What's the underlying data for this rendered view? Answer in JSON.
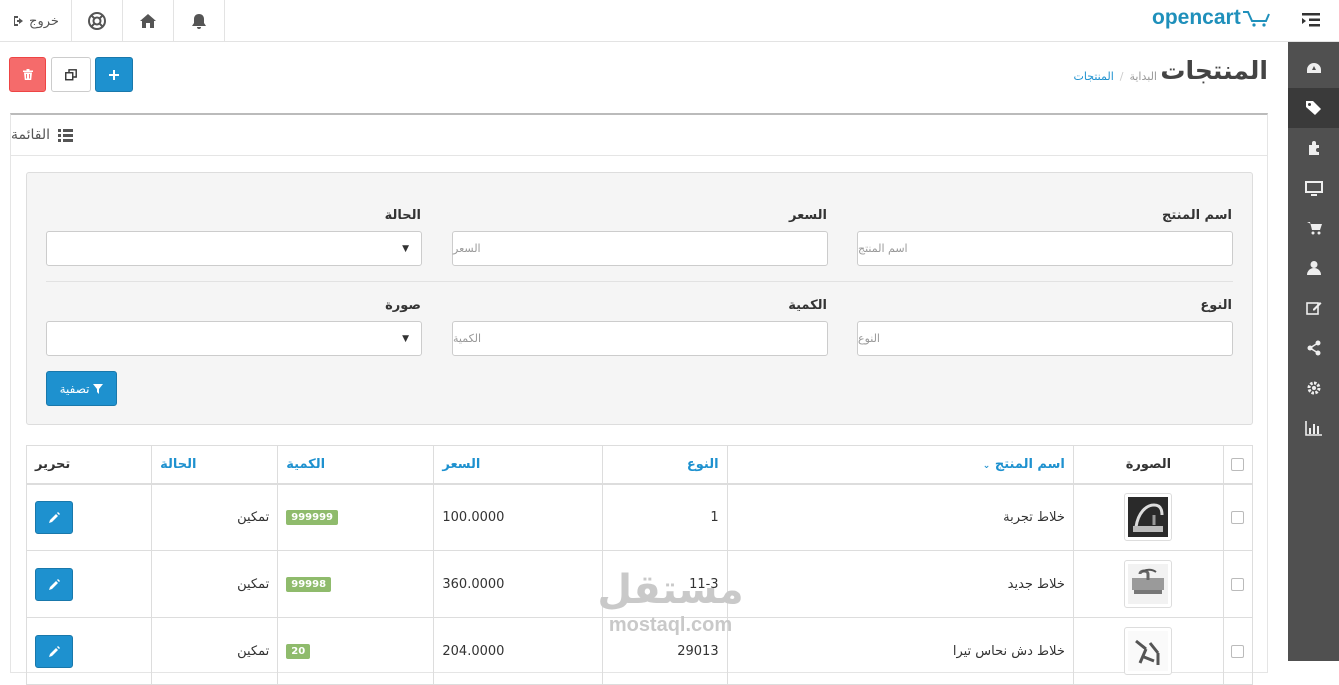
{
  "header": {
    "logo_text": "opencart",
    "logout_label": "خروج"
  },
  "page": {
    "title": "المنتجات",
    "breadcrumb": [
      "البداية",
      "المنتجات"
    ]
  },
  "panel": {
    "title": "القائمة"
  },
  "filter": {
    "name_label": "اسم المنتج",
    "name_placeholder": "اسم المنتج",
    "price_label": "السعر",
    "price_placeholder": "السعر",
    "status_label": "الحالة",
    "model_label": "النوع",
    "model_placeholder": "النوع",
    "quantity_label": "الكمية",
    "quantity_placeholder": "الكمية",
    "image_label": "صورة",
    "button_label": "تصفية"
  },
  "table": {
    "headers": {
      "image": "الصورة",
      "name": "اسم المنتج",
      "model": "النوع",
      "price": "السعر",
      "quantity": "الكمية",
      "status": "الحالة",
      "action": "تحرير"
    },
    "rows": [
      {
        "name": "خلاط تجربة",
        "model": "1",
        "price": "100.0000",
        "quantity": "999999",
        "status": "تمكين"
      },
      {
        "name": "خلاط جديد",
        "model": "11-3",
        "price": "360.0000",
        "quantity": "99998",
        "status": "تمكين"
      },
      {
        "name": "خلاط دش نحاس تيرا",
        "model": "29013",
        "price": "204.0000",
        "quantity": "20",
        "status": "تمكين"
      }
    ]
  },
  "watermark": {
    "arabic": "مستقل",
    "latin": "mostaql.com"
  },
  "colors": {
    "primary": "#1e91cf",
    "danger": "#f56b6b",
    "success_badge": "#8fbb6c",
    "sidebar": "#505050"
  }
}
